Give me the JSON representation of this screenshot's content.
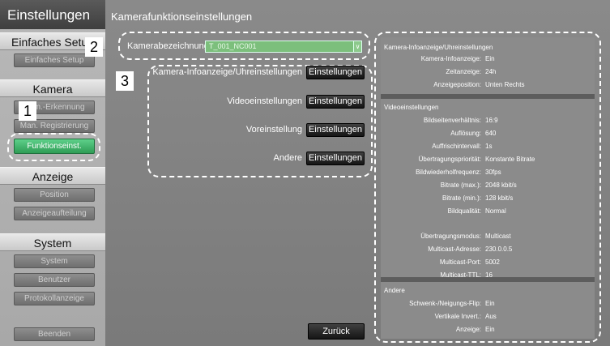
{
  "sidebar": {
    "title": "Einstellungen",
    "sections": [
      {
        "heading": "Einfaches Setup",
        "items": [
          "Einfaches Setup"
        ]
      },
      {
        "heading": "Kamera",
        "items": [
          "Kam.-Erkennung",
          "Man. Registrierung",
          "Funktionseinst."
        ]
      },
      {
        "heading": "Anzeige",
        "items": [
          "Position",
          "Anzeigeaufteilung"
        ]
      },
      {
        "heading": "System",
        "items": [
          "System",
          "Benutzer",
          "Protokollanzeige"
        ]
      }
    ],
    "exit_label": "Beenden"
  },
  "main": {
    "title": "Kamerafunktionseinstellungen",
    "camera_name_label": "Kamerabezeichnung",
    "camera_name_value": "T_001_NC001",
    "settings": [
      {
        "label": "Kamera-Infoanzeige/Uhreinstellungen",
        "button": "Einstellungen"
      },
      {
        "label": "Videoeinstellungen",
        "button": "Einstellungen"
      },
      {
        "label": "Voreinstellung",
        "button": "Einstellungen"
      },
      {
        "label": "Andere",
        "button": "Einstellungen"
      }
    ],
    "back_label": "Zurück"
  },
  "info": {
    "sections": [
      {
        "heading": "Kamera-Infoanzeige/Uhreinstellungen",
        "rows": [
          {
            "k": "Kamera-Infoanzeige:",
            "v": "Ein"
          },
          {
            "k": "Zeitanzeige:",
            "v": "24h"
          },
          {
            "k": "Anzeigeposition:",
            "v": "Unten Rechts"
          }
        ]
      },
      {
        "heading": "Videoeinstellungen",
        "rows": [
          {
            "k": "Bildseitenverhältnis:",
            "v": "16:9"
          },
          {
            "k": "Auflösung:",
            "v": "640"
          },
          {
            "k": "Auffrischintervall:",
            "v": "1s"
          },
          {
            "k": "Übertragungspriorität:",
            "v": "Konstante Bitrate"
          },
          {
            "k": "Bildwiederholfrequenz:",
            "v": "30fps"
          },
          {
            "k": "Bitrate (max.):",
            "v": "2048 kbit/s"
          },
          {
            "k": "Bitrate (min.):",
            "v": "128 kbit/s"
          },
          {
            "k": "Bildqualität:",
            "v": "Normal"
          },
          {
            "k": "Übertragungsmodus:",
            "v": "Multicast"
          },
          {
            "k": "Multicast-Adresse:",
            "v": "230.0.0.5"
          },
          {
            "k": "Multicast-Port:",
            "v": "5002"
          },
          {
            "k": "Multicast-TTL:",
            "v": "16"
          }
        ]
      },
      {
        "heading": "Andere",
        "rows": [
          {
            "k": "Schwenk-/Neigungs-Flip:",
            "v": "Ein"
          },
          {
            "k": "Vertikale Invert.:",
            "v": "Aus"
          },
          {
            "k": "Anzeige:",
            "v": "Ein"
          }
        ]
      }
    ]
  },
  "callouts": [
    "1",
    "2",
    "3"
  ]
}
